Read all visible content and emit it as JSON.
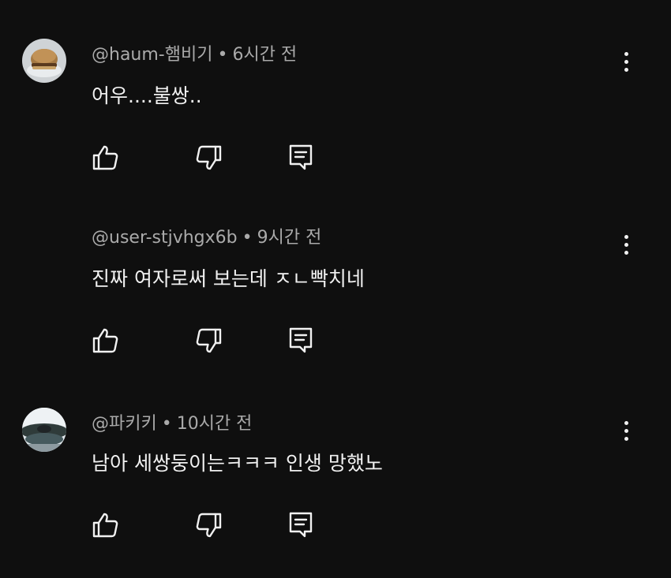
{
  "comments": [
    {
      "author": "@haum-햄비기",
      "time": "6시간 전",
      "text": "어우....불쌍..",
      "avatar": "burger-photo",
      "has_avatar": true
    },
    {
      "author": "@user-stjvhgx6b",
      "time": "9시간 전",
      "text": "진짜 여자로써 보는데 ㅈㄴ빡치네",
      "avatar": "none",
      "has_avatar": false
    },
    {
      "author": "@파키키",
      "time": "10시간 전",
      "text": "남아 세쌍둥이는ㅋㅋㅋ 인생 망했노",
      "avatar": "landscape-photo",
      "has_avatar": true
    }
  ],
  "separator": "•",
  "icons": {
    "like": "thumbs-up-icon",
    "dislike": "thumbs-down-icon",
    "reply": "reply-icon",
    "more": "more-vertical-icon"
  },
  "colors": {
    "background": "#0f0f0f",
    "primary_text": "#f1f1f1",
    "secondary_text": "#aaaaaa"
  }
}
